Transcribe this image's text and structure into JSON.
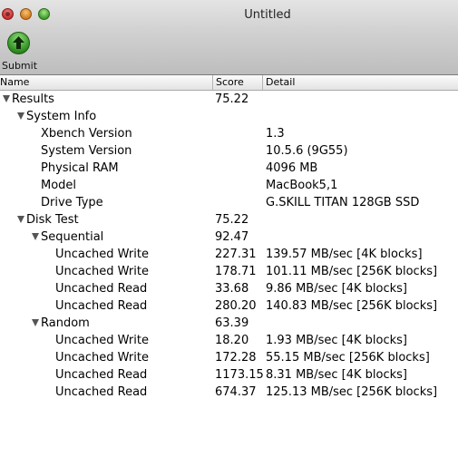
{
  "window": {
    "title": "Untitled"
  },
  "toolbar": {
    "submit_label": "Submit",
    "submit_icon": "up-arrow-icon"
  },
  "columns": {
    "name": "Name",
    "score": "Score",
    "detail": "Detail"
  },
  "rows": [
    {
      "name": "Results",
      "score": "75.22",
      "detail": ""
    },
    {
      "name": "System Info",
      "score": "",
      "detail": ""
    },
    {
      "name": "Xbench Version",
      "score": "",
      "detail": "1.3"
    },
    {
      "name": "System Version",
      "score": "",
      "detail": "10.5.6 (9G55)"
    },
    {
      "name": "Physical RAM",
      "score": "",
      "detail": "4096 MB"
    },
    {
      "name": "Model",
      "score": "",
      "detail": "MacBook5,1"
    },
    {
      "name": "Drive Type",
      "score": "",
      "detail": "G.SKILL TITAN 128GB SSD"
    },
    {
      "name": "Disk Test",
      "score": "75.22",
      "detail": ""
    },
    {
      "name": "Sequential",
      "score": "92.47",
      "detail": ""
    },
    {
      "name": "Uncached Write",
      "score": "227.31",
      "detail": "139.57 MB/sec [4K blocks]"
    },
    {
      "name": "Uncached Write",
      "score": "178.71",
      "detail": "101.11 MB/sec [256K blocks]"
    },
    {
      "name": "Uncached Read",
      "score": "33.68",
      "detail": "9.86 MB/sec [4K blocks]"
    },
    {
      "name": "Uncached Read",
      "score": "280.20",
      "detail": "140.83 MB/sec [256K blocks]"
    },
    {
      "name": "Random",
      "score": "63.39",
      "detail": ""
    },
    {
      "name": "Uncached Write",
      "score": "18.20",
      "detail": "1.93 MB/sec [4K blocks]"
    },
    {
      "name": "Uncached Write",
      "score": "172.28",
      "detail": "55.15 MB/sec [256K blocks]"
    },
    {
      "name": "Uncached Read",
      "score": "1173.15",
      "detail": "8.31 MB/sec [4K blocks]"
    },
    {
      "name": "Uncached Read",
      "score": "674.37",
      "detail": "125.13 MB/sec [256K blocks]"
    }
  ]
}
